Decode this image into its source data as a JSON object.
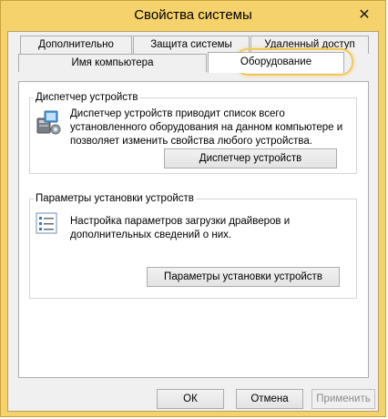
{
  "window": {
    "title": "Свойства системы",
    "close_glyph": "✕"
  },
  "tabs": {
    "row1": [
      "Дополнительно",
      "Защита системы",
      "Удаленный доступ"
    ],
    "row2": [
      "Имя компьютера",
      "Оборудование"
    ],
    "active": "Оборудование"
  },
  "device_manager": {
    "title": "Диспетчер устройств",
    "description_lines": [
      "Диспетчер устройств приводит список всего",
      "установленного оборудования на данном компьютере и",
      "позволяет изменить свойства любого устройства."
    ],
    "button": "Диспетчер устройств",
    "icon": "device-manager-icon"
  },
  "install_settings": {
    "title": "Параметры установки устройств",
    "description_lines": [
      "Настройка параметров загрузки драйверов и",
      "дополнительных сведений о них."
    ],
    "button": "Параметры установки устройств",
    "icon": "checklist-icon"
  },
  "footer": {
    "ok": "ОК",
    "cancel": "Отмена",
    "apply": "Применить"
  },
  "colors": {
    "window_frame": "#f5d26b",
    "highlight": "#f2c85a"
  }
}
